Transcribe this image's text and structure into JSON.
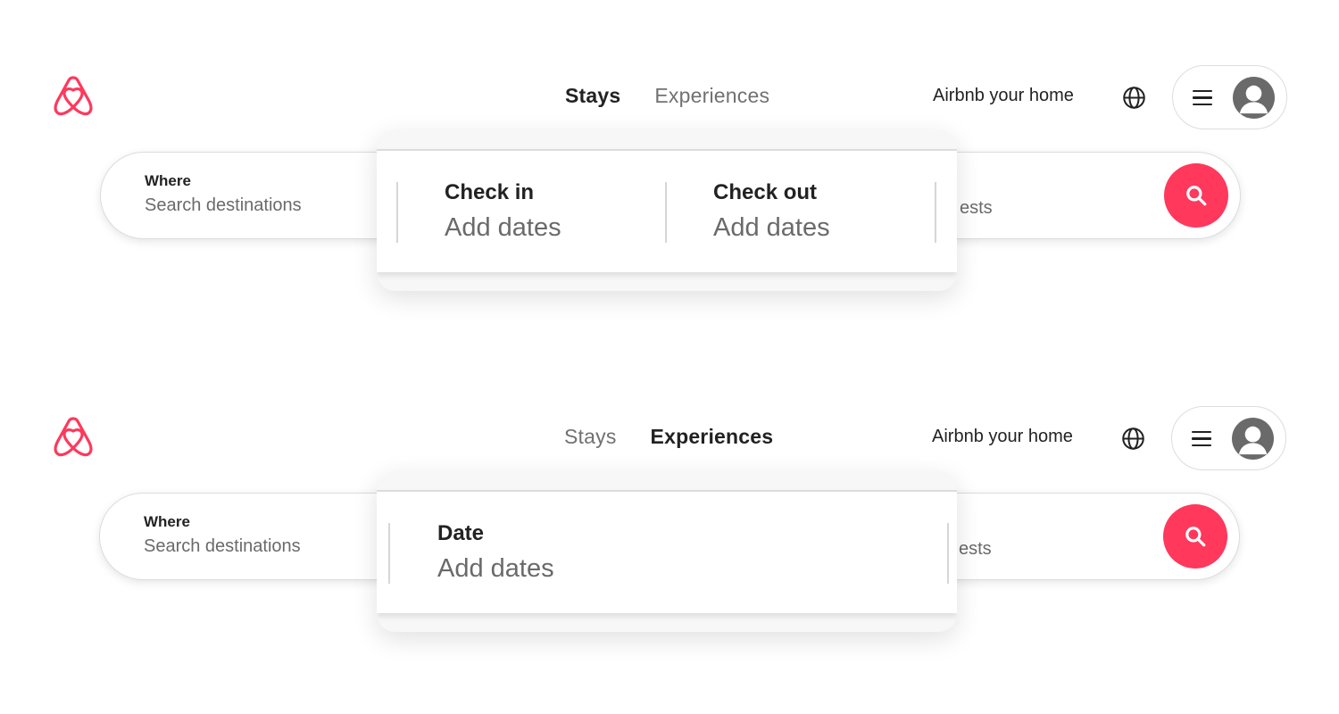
{
  "brand": {
    "name": "Airbnb",
    "accent_color": "#ff385c",
    "logo_icon": "airbnb-belo-logo"
  },
  "variants": [
    {
      "nav_tabs": [
        {
          "label": "Stays",
          "active": true
        },
        {
          "label": "Experiences",
          "active": false
        }
      ],
      "host_link": "Airbnb your home",
      "globe_icon": "globe-icon",
      "user_menu": {
        "menu_icon": "hamburger-icon",
        "avatar_icon": "user-avatar-icon"
      },
      "search": {
        "where_label": "Where",
        "where_placeholder": "Search destinations",
        "guests_fragment": "ests",
        "search_icon": "search-icon"
      },
      "date_popup": {
        "fields": [
          {
            "label": "Check in",
            "value": "Add dates"
          },
          {
            "label": "Check out",
            "value": "Add dates"
          }
        ]
      }
    },
    {
      "nav_tabs": [
        {
          "label": "Stays",
          "active": false
        },
        {
          "label": "Experiences",
          "active": true
        }
      ],
      "host_link": "Airbnb your home",
      "globe_icon": "globe-icon",
      "user_menu": {
        "menu_icon": "hamburger-icon",
        "avatar_icon": "user-avatar-icon"
      },
      "search": {
        "where_label": "Where",
        "where_placeholder": "Search destinations",
        "guests_fragment": "ests",
        "search_icon": "search-icon"
      },
      "date_popup": {
        "fields": [
          {
            "label": "Date",
            "value": "Add dates"
          }
        ]
      }
    }
  ]
}
